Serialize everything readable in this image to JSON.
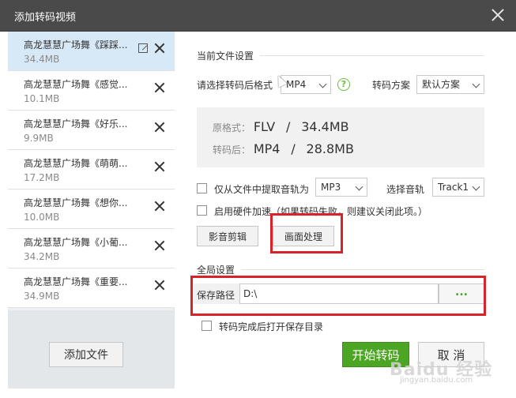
{
  "window": {
    "title": "添加转码视频"
  },
  "files": [
    {
      "name": "高龙慧慧广场舞《踩踩...",
      "size": "34.4MB",
      "active": true
    },
    {
      "name": "高龙慧慧广场舞《感觉...",
      "size": "10.1MB",
      "active": false
    },
    {
      "name": "高龙慧慧广场舞《好乐...",
      "size": "9.9MB",
      "active": false
    },
    {
      "name": "高龙慧慧广场舞《萌萌...",
      "size": "17.2MB",
      "active": false
    },
    {
      "name": "高龙慧慧广场舞《想你...",
      "size": "10.0MB",
      "active": false
    },
    {
      "name": "高龙慧慧广场舞《小葡...",
      "size": "34.2MB",
      "active": false
    },
    {
      "name": "高龙慧慧广场舞《重要...",
      "size": "34.9MB",
      "active": false
    }
  ],
  "left_footer": {
    "add_file": "添加文件"
  },
  "current_settings": {
    "title": "当前文件设置",
    "format_label": "请选择转码后格式",
    "format_value": "MP4",
    "help_icon": "?",
    "scheme_label": "转码方案",
    "scheme_value": "默认方案",
    "original_label": "原格式：",
    "original_format": "FLV",
    "original_sep": "/",
    "original_size": "34.4MB",
    "converted_label": "转码后：",
    "converted_format": "MP4",
    "converted_sep": "/",
    "converted_size": "28.8MB",
    "audio_extract_label": "仅从文件中提取音轨为",
    "audio_extract_value": "MP3",
    "track_label": "选择音轨",
    "track_value": "Track1",
    "hw_accel_label": "启用硬件加速（如果转码失败，则建议关闭此项。）",
    "btn_video_edit": "影音剪辑",
    "btn_picture": "画面处理"
  },
  "global_settings": {
    "title": "全局设置",
    "save_path_label": "保存路径",
    "save_path_value": "D:\\",
    "browse": "...",
    "open_dir_label": "转码完成后打开保存目录"
  },
  "actions": {
    "start": "开始转码",
    "cancel": "取 消"
  },
  "watermark": {
    "main": "Baidu 经验",
    "sub": "jingyan.baidu.com"
  },
  "colors": {
    "accent_green": "#4da623",
    "highlight_red": "#d8232a",
    "title_bar": "#4a4a4a"
  }
}
